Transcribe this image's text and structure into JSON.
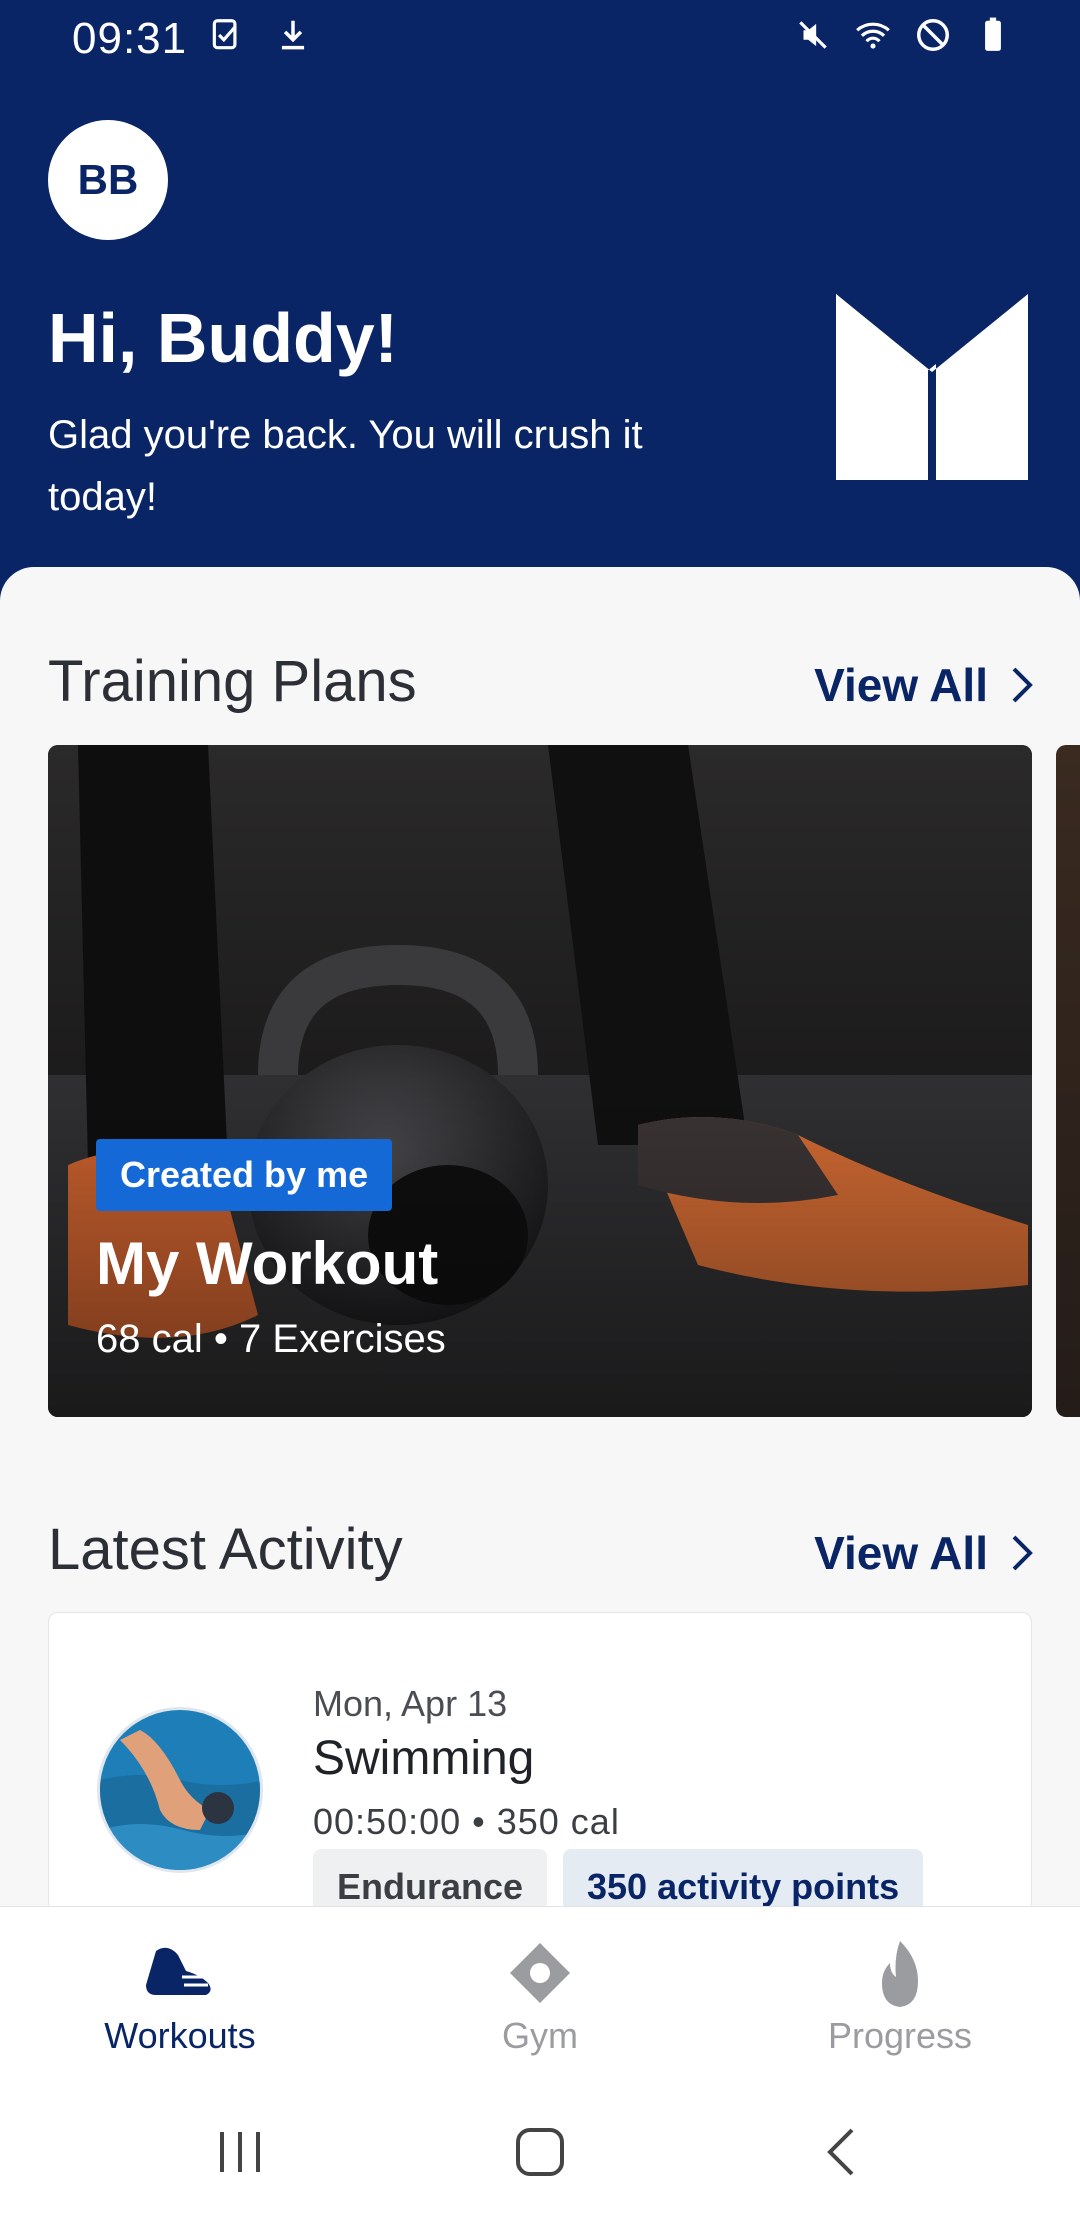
{
  "status_bar": {
    "time": "09:31",
    "left_icons": [
      "task-check-icon",
      "download-icon"
    ],
    "right_icons": [
      "mute-icon",
      "wifi-icon",
      "do-not-disturb-icon",
      "battery-icon"
    ]
  },
  "header": {
    "avatar_initials": "BB",
    "greeting": "Hi, Buddy!",
    "subgreeting": "Glad you're back. You will crush it today!",
    "logo_icon": "brand-logo-icon",
    "background": "#0a2566"
  },
  "training_plans": {
    "title": "Training Plans",
    "view_all": "View All",
    "cards": [
      {
        "badge": "Created by me",
        "title": "My Workout",
        "meta": "68 cal • 7 Exercises"
      }
    ]
  },
  "latest_activity": {
    "title": "Latest Activity",
    "view_all": "View All",
    "items": [
      {
        "date": "Mon, Apr 13",
        "name": "Swimming",
        "stats": "00:50:00 • 350 cal",
        "tags": [
          "Endurance",
          "350 activity points"
        ]
      }
    ]
  },
  "bottom_nav": {
    "items": [
      {
        "label": "Workouts",
        "icon": "shoe-icon",
        "active": true
      },
      {
        "label": "Gym",
        "icon": "location-pin-icon",
        "active": false
      },
      {
        "label": "Progress",
        "icon": "flame-icon",
        "active": false
      }
    ]
  },
  "colors": {
    "primary": "#0a2566",
    "badge": "#1469d6",
    "inactive": "#9a9ca0"
  }
}
